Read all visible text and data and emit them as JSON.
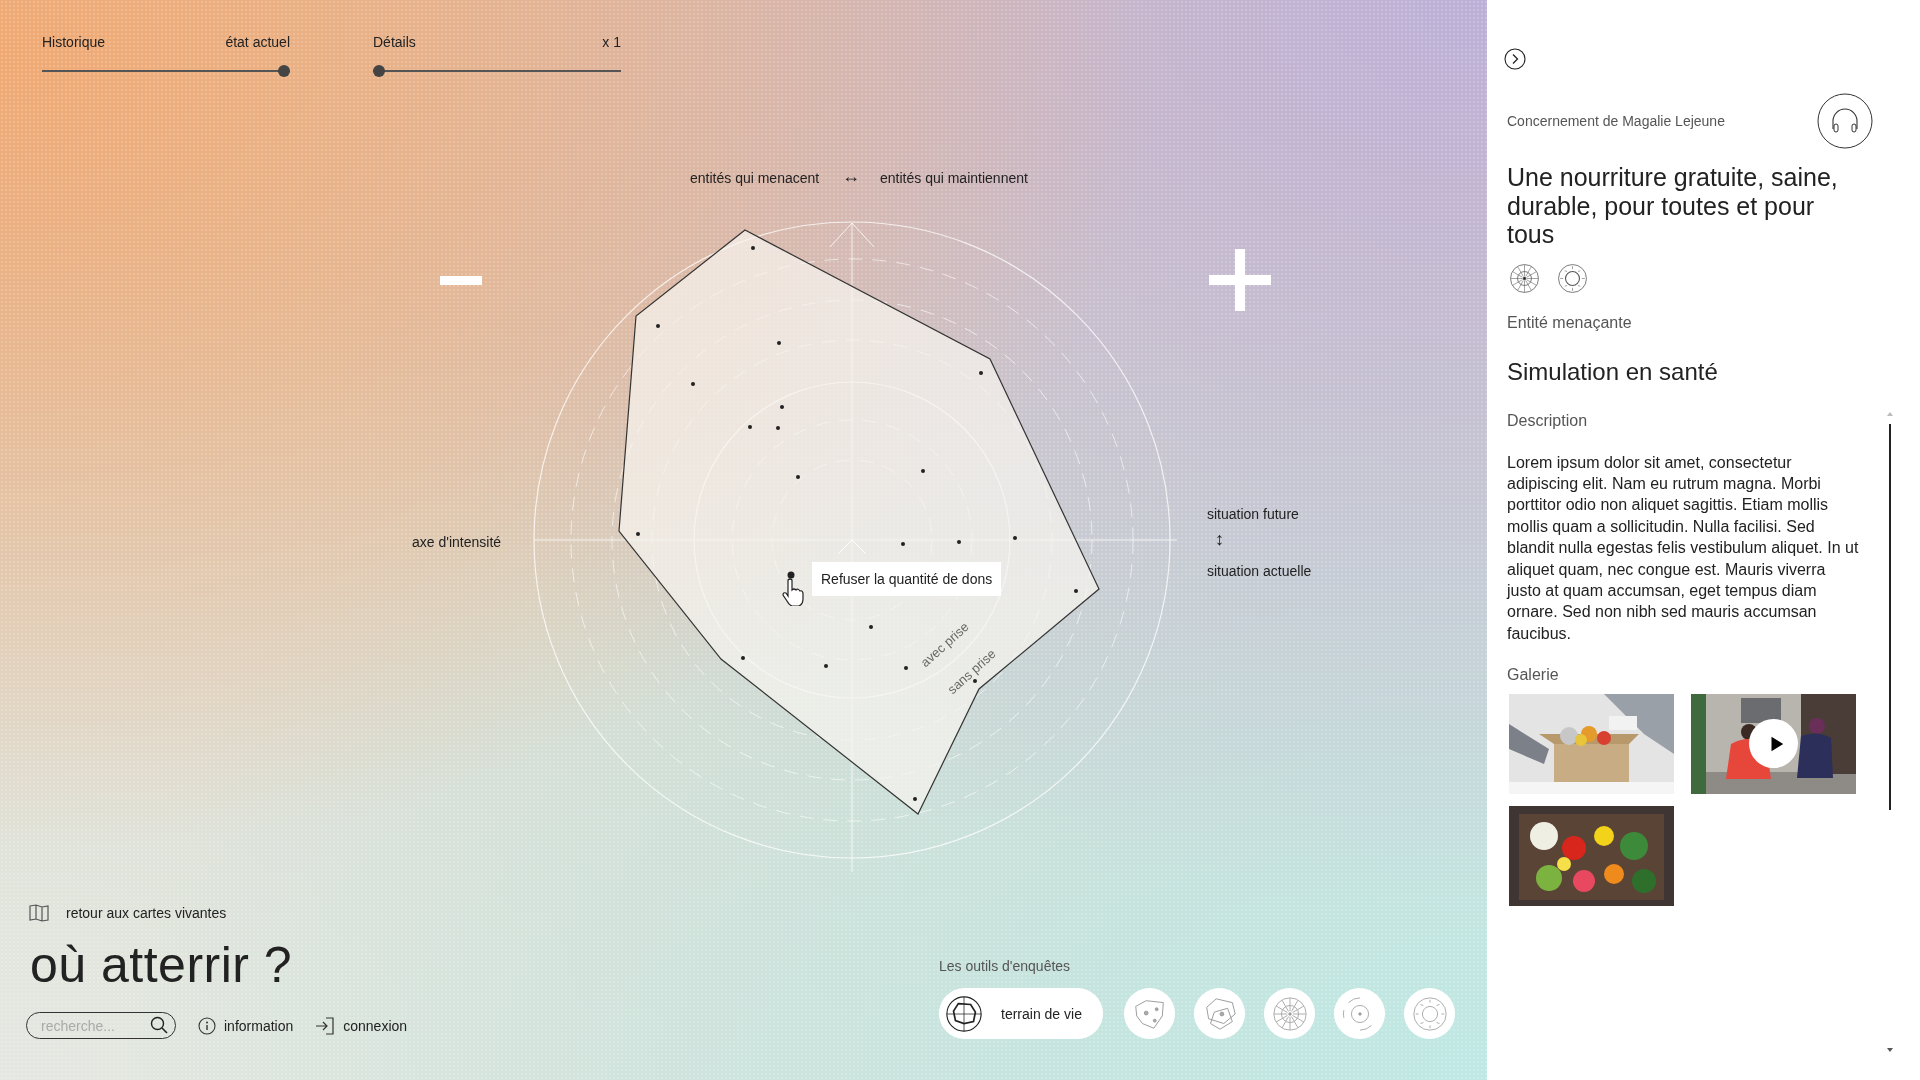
{
  "sliders": [
    {
      "label": "Historique",
      "reading": "état actuel",
      "level": 1
    },
    {
      "label": "Détails",
      "reading": "x 1",
      "level": 0
    }
  ],
  "chart": {
    "top_left_label": "entités qui menacent",
    "top_arrow": "↔",
    "top_right_label": "entités qui maintiennent",
    "left_label": "axe d'intensité",
    "right_top_label": "situation future",
    "right_arrow": "↕",
    "right_bottom_label": "situation actuelle",
    "ring_labels": [
      "avec prise",
      "sans prise"
    ],
    "tooltip": "Refuser la quantité de dons"
  },
  "back_link": "retour aux cartes vivantes",
  "app_title": "où atterrir ?",
  "search": {
    "placeholder": "recherche..."
  },
  "links": [
    {
      "label": "information",
      "kind": "info"
    },
    {
      "label": "connexion",
      "kind": "login"
    }
  ],
  "tools": {
    "title": "Les outils d'enquêtes",
    "items": [
      {
        "kind": "terrain",
        "label": "terrain de vie",
        "selected": true
      },
      {
        "kind": "islands",
        "selected": false
      },
      {
        "kind": "polygons",
        "selected": false
      },
      {
        "kind": "wheel",
        "selected": false
      },
      {
        "kind": "target",
        "selected": false
      },
      {
        "kind": "compass",
        "selected": false
      }
    ]
  },
  "panel": {
    "owner": "Concernement de Magalie Lejeune",
    "title": "Une nourriture gratuite, saine, durable, pour toutes et pour tous",
    "tool_icons": [
      {
        "kind": "wheel"
      },
      {
        "kind": "compass"
      }
    ],
    "entity_type": "Entité menaçante",
    "entity_name": "Simulation en santé",
    "description_heading": "Description",
    "description": "Lorem ipsum dolor sit amet, consectetur adipiscing elit. Nam eu rutrum magna. Morbi porttitor odio non aliquet sagittis. Etiam mollis mollis quam a sollicitudin. Nulla facilisi. Sed blandit nulla egestas felis vestibulum aliquet. In ut aliquet quam, nec congue est. Mauris viverra justo at quam accumsan, eget tempus diam ornare. Sed non nibh sed mauris accumsan faucibus.",
    "gallery_heading": "Galerie",
    "gallery": [
      {
        "kind": "picture"
      },
      {
        "kind": "video"
      },
      {
        "kind": "picture"
      }
    ]
  }
}
